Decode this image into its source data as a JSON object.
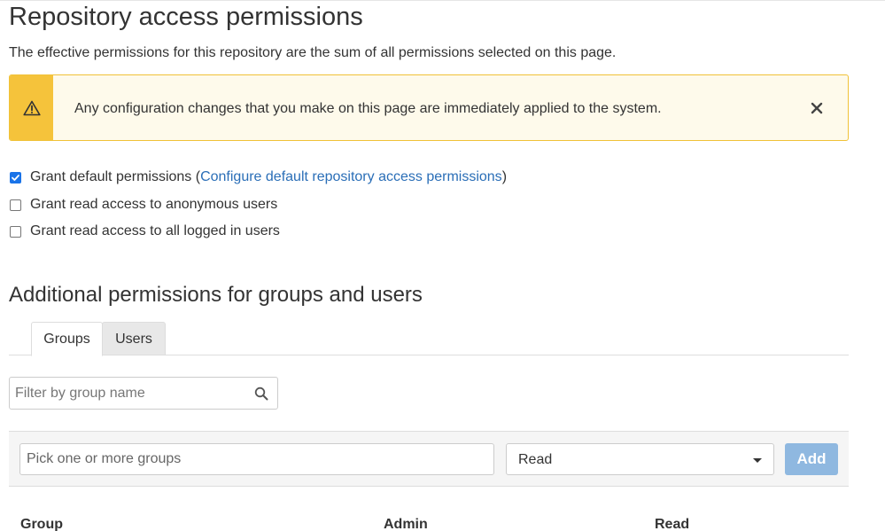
{
  "page": {
    "title": "Repository access permissions",
    "description": "The effective permissions for this repository are the sum of all permissions selected on this page."
  },
  "alert": {
    "message": "Any configuration changes that you make on this page are immediately applied to the system.",
    "icon": "warning-icon",
    "close_icon": "close-icon",
    "colors": {
      "side": "#f5c33b",
      "background": "#fefaeb",
      "border": "#f0c238"
    }
  },
  "options": {
    "default_permissions": {
      "checked": true,
      "label": "Grant default permissions (",
      "link": "Configure default repository access permissions",
      "suffix": ")"
    },
    "anonymous": {
      "checked": false,
      "label": "Grant read access to anonymous users"
    },
    "logged_in": {
      "checked": false,
      "label": "Grant read access to all logged in users"
    }
  },
  "section": {
    "title": "Additional permissions for groups and users"
  },
  "tabs": [
    {
      "label": "Groups",
      "active": true
    },
    {
      "label": "Users",
      "active": false
    }
  ],
  "filter": {
    "placeholder": "Filter by group name",
    "icon": "search-icon"
  },
  "add_panel": {
    "pick_placeholder": "Pick one or more groups",
    "permission_selected": "Read",
    "add_label": "Add",
    "add_color": "#8fb8e0"
  },
  "table": {
    "headers": [
      "Group",
      "Admin",
      "Read"
    ]
  }
}
